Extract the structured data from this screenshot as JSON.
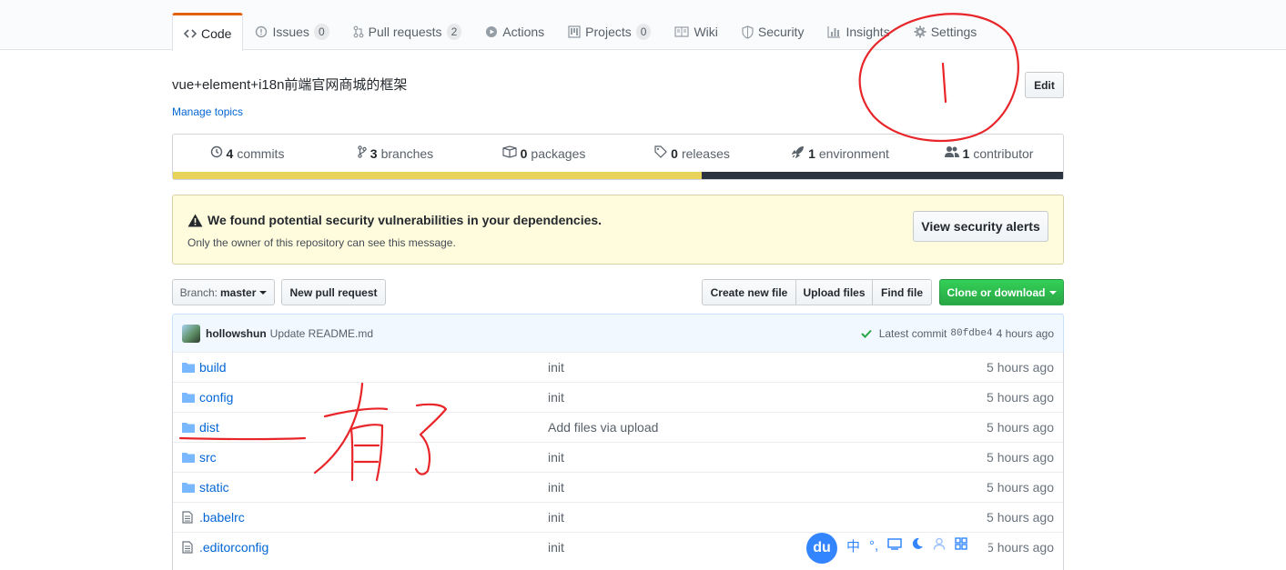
{
  "tabs": [
    {
      "label": "Code",
      "icon": "code-icon"
    },
    {
      "label": "Issues",
      "icon": "issue-icon",
      "count": "0"
    },
    {
      "label": "Pull requests",
      "icon": "pull-request-icon",
      "count": "2"
    },
    {
      "label": "Actions",
      "icon": "play-icon"
    },
    {
      "label": "Projects",
      "icon": "project-icon",
      "count": "0"
    },
    {
      "label": "Wiki",
      "icon": "book-icon"
    },
    {
      "label": "Security",
      "icon": "shield-icon"
    },
    {
      "label": "Insights",
      "icon": "graph-icon"
    },
    {
      "label": "Settings",
      "icon": "gear-icon"
    }
  ],
  "repo": {
    "description": "vue+element+i18n前端官网商城的框架",
    "manage_topics": "Manage topics",
    "edit_label": "Edit"
  },
  "summary": {
    "commits_num": "4",
    "commits_label": "commits",
    "branches_num": "3",
    "branches_label": "branches",
    "packages_num": "0",
    "packages_label": "packages",
    "releases_num": "0",
    "releases_label": "releases",
    "environment_num": "1",
    "environment_label": "environment",
    "contributor_num": "1",
    "contributor_label": "contributor",
    "languages": [
      {
        "color": "#e8d35a",
        "share": 0.585
      },
      {
        "color": "#2b3440",
        "share": 0.4
      }
    ]
  },
  "alert": {
    "title": "We found potential security vulnerabilities in your dependencies.",
    "subtitle": "Only the owner of this repository can see this message.",
    "button": "View security alerts"
  },
  "toolbar": {
    "branch_prefix": "Branch:",
    "branch_name": "master",
    "new_pull_request": "New pull request",
    "create_new_file": "Create new file",
    "upload_files": "Upload files",
    "find_file": "Find file",
    "clone_or_download": "Clone or download"
  },
  "commit": {
    "author": "hollowshun",
    "message": "Update README.md",
    "latest_label": "Latest commit",
    "sha": "80fdbe4",
    "age": "4 hours ago"
  },
  "files": [
    {
      "type": "folder",
      "name": "build",
      "message": "init",
      "age": "5 hours ago"
    },
    {
      "type": "folder",
      "name": "config",
      "message": "init",
      "age": "5 hours ago"
    },
    {
      "type": "folder",
      "name": "dist",
      "message": "Add files via upload",
      "age": "5 hours ago"
    },
    {
      "type": "folder",
      "name": "src",
      "message": "init",
      "age": "5 hours ago"
    },
    {
      "type": "folder",
      "name": "static",
      "message": "init",
      "age": "5 hours ago"
    },
    {
      "type": "file",
      "name": ".babelrc",
      "message": "init",
      "age": "5 hours ago"
    },
    {
      "type": "file",
      "name": ".editorconfig",
      "message": "init",
      "age": "5 hours ago"
    }
  ],
  "ime": {
    "logo": "du",
    "lang": "中",
    "punct": "°,"
  },
  "colors": {
    "accent": "#e36209",
    "link": "#0366d6",
    "green": "#28a745",
    "annotation": "#e8262a"
  }
}
